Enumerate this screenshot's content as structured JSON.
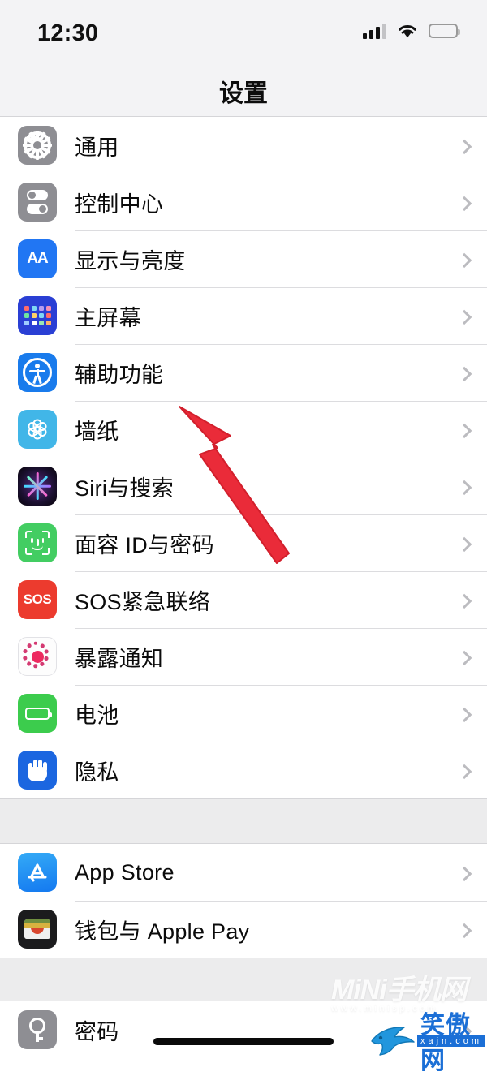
{
  "status_bar": {
    "time": "12:30",
    "signal_icon": "cellular-signal-icon",
    "wifi_icon": "wifi-icon",
    "battery_icon": "battery-full-icon"
  },
  "nav": {
    "title": "设置"
  },
  "groups": [
    {
      "id": "group-system",
      "items": [
        {
          "label": "通用",
          "icon": "gear-icon",
          "icon_class": "ic-gear"
        },
        {
          "label": "控制中心",
          "icon": "control-center-icon",
          "icon_class": "ic-control"
        },
        {
          "label": "显示与亮度",
          "icon": "display-brightness-icon",
          "icon_class": "ic-display"
        },
        {
          "label": "主屏幕",
          "icon": "home-screen-icon",
          "icon_class": "ic-home"
        },
        {
          "label": "辅助功能",
          "icon": "accessibility-icon",
          "icon_class": "ic-access"
        },
        {
          "label": "墙纸",
          "icon": "wallpaper-icon",
          "icon_class": "ic-wallpaper"
        },
        {
          "label": "Siri与搜索",
          "icon": "siri-icon",
          "icon_class": "ic-siri"
        },
        {
          "label": "面容 ID与密码",
          "icon": "face-id-icon",
          "icon_class": "ic-faceid"
        },
        {
          "label": "SOS紧急联络",
          "icon": "emergency-sos-icon",
          "icon_class": "ic-sos"
        },
        {
          "label": "暴露通知",
          "icon": "exposure-notifications-icon",
          "icon_class": "ic-exposure"
        },
        {
          "label": "电池",
          "icon": "battery-icon",
          "icon_class": "ic-battery"
        },
        {
          "label": "隐私",
          "icon": "privacy-hand-icon",
          "icon_class": "ic-privacy"
        }
      ]
    },
    {
      "id": "group-store",
      "items": [
        {
          "label": "App Store",
          "icon": "app-store-icon",
          "icon_class": "ic-appstore"
        },
        {
          "label": "钱包与 Apple Pay",
          "icon": "wallet-icon",
          "icon_class": "ic-wallet"
        }
      ]
    },
    {
      "id": "group-passwords",
      "items": [
        {
          "label": "密码",
          "icon": "passwords-key-icon",
          "icon_class": "ic-password"
        }
      ]
    }
  ],
  "annotation": {
    "cursor_icon": "red-arrow-pointer",
    "cursor_color": "#ea2b39",
    "points_at": "辅助功能"
  },
  "watermarks": {
    "primary": "MiNi手机网",
    "primary_sub": "www.minisp.com",
    "secondary": "笑傲网",
    "secondary_domain": "xajn.com",
    "logo_icon": "shark-logo-icon",
    "logo_color": "#2196dd"
  },
  "home_indicator": {
    "icon": "home-indicator-bar"
  },
  "colors": {
    "page_background": "#ececed",
    "row_background": "#ffffff",
    "separator": "#dcdcdf",
    "chevron": "#bcbcc0",
    "text": "#0b0b0b"
  }
}
